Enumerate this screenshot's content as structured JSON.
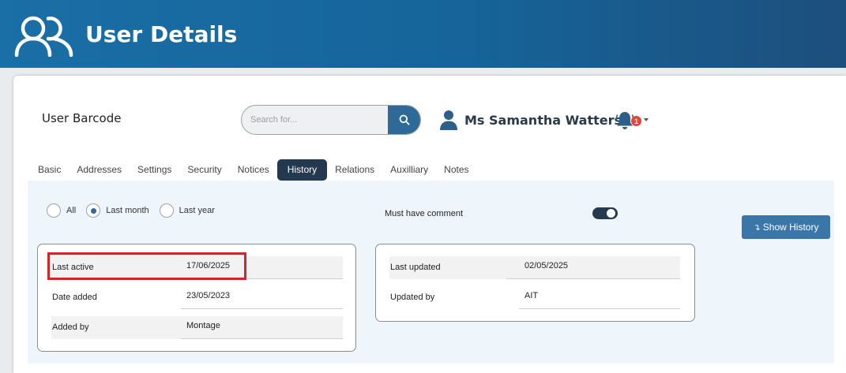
{
  "header": {
    "title": "User Details",
    "icon": "users-icon"
  },
  "page": {
    "barcode_label": "User Barcode"
  },
  "search": {
    "placeholder": "Search for...",
    "value": "",
    "icon": "search-icon"
  },
  "user": {
    "name": "Ms Samantha Watters",
    "icon": "person-icon"
  },
  "notifications": {
    "count": "1",
    "icon": "bell-icon"
  },
  "tabs": [
    {
      "label": "Basic",
      "active": false
    },
    {
      "label": "Addresses",
      "active": false
    },
    {
      "label": "Settings",
      "active": false
    },
    {
      "label": "Security",
      "active": false
    },
    {
      "label": "Notices",
      "active": false
    },
    {
      "label": "History",
      "active": true
    },
    {
      "label": "Relations",
      "active": false
    },
    {
      "label": "Auxilliary",
      "active": false
    },
    {
      "label": "Notes",
      "active": false
    }
  ],
  "filters": {
    "options": [
      {
        "label": "All",
        "checked": false
      },
      {
        "label": "Last month",
        "checked": true
      },
      {
        "label": "Last year",
        "checked": false
      }
    ],
    "comment_label": "Must have comment",
    "comment_toggle_on": true
  },
  "actions": {
    "show_history": "Show History"
  },
  "left_card": {
    "rows": [
      {
        "label": "Last active",
        "value": "17/06/2025"
      },
      {
        "label": "Date added",
        "value": "23/05/2023"
      },
      {
        "label": "Added by",
        "value": "Montage"
      }
    ]
  },
  "right_card": {
    "rows": [
      {
        "label": "Last updated",
        "value": "02/05/2025"
      },
      {
        "label": "Updated by",
        "value": "AIT"
      }
    ]
  },
  "colors": {
    "header": "#1a6fa6",
    "active_tab": "#24394f",
    "button": "#3a77a8",
    "highlight": "#d0262a",
    "badge": "#e0463a"
  }
}
